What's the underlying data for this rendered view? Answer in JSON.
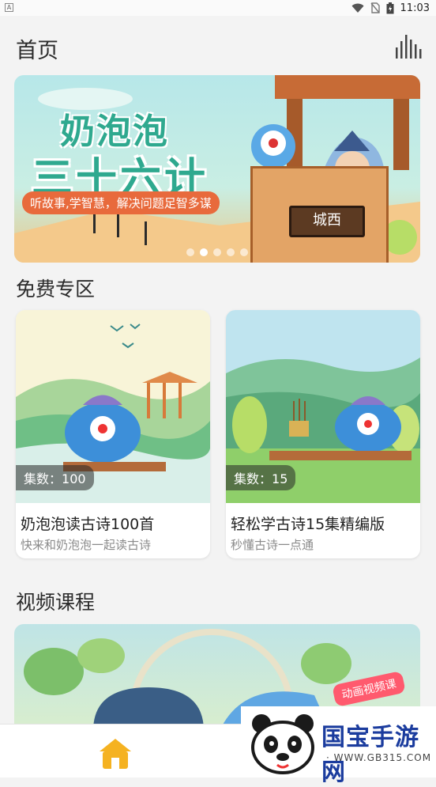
{
  "status_bar": {
    "app_icon": "A",
    "time": "11:03"
  },
  "header": {
    "title": "首页",
    "menu_icon": "equalizer-icon"
  },
  "banner": {
    "title_line1": "奶泡泡",
    "title_line2": "三十六计",
    "tagline": "听故事,学智慧，解决问题足智多谋",
    "gate_sign": "城西",
    "dots": 5,
    "active_dot": 1
  },
  "free_section": {
    "title": "免费专区",
    "items": [
      {
        "count_label": "集数：",
        "count": "100",
        "title": "奶泡泡读古诗100首",
        "subtitle": "快来和奶泡泡一起读古诗"
      },
      {
        "count_label": "集数：",
        "count": "15",
        "title": "轻松学古诗15集精编版",
        "subtitle": "秒懂古诗一点通"
      }
    ]
  },
  "video_section": {
    "title": "视频课程",
    "badge": "动画视频课"
  },
  "tab_bar": {
    "home_icon": "home-icon"
  },
  "watermark": {
    "brand": "国宝手游网",
    "url": "· WWW.GB315.COM ·"
  },
  "colors": {
    "accent": "#f5b221",
    "banner_green": "#2fa98f",
    "tagline_bg": "#e86a3c"
  }
}
